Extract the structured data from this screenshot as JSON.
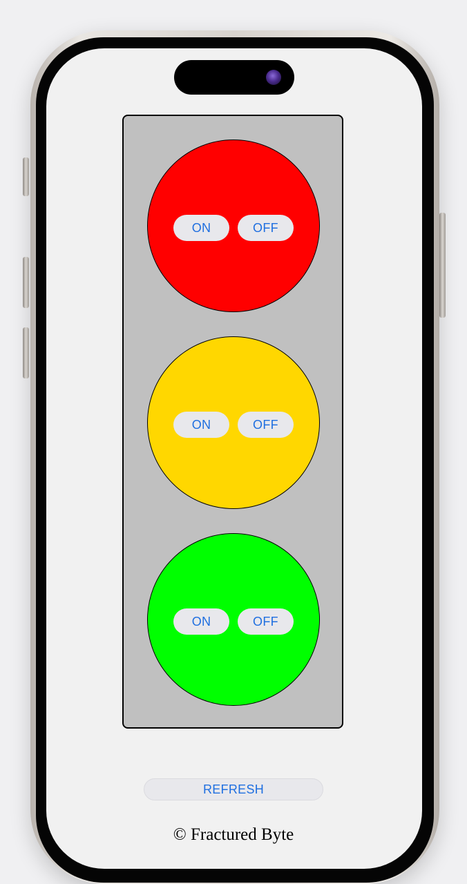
{
  "lights": [
    {
      "color_name": "red",
      "color": "#ff0000",
      "on_label": "ON",
      "off_label": "OFF"
    },
    {
      "color_name": "yellow",
      "color": "#ffd700",
      "on_label": "ON",
      "off_label": "OFF"
    },
    {
      "color_name": "green",
      "color": "#00ff00",
      "on_label": "ON",
      "off_label": "OFF"
    }
  ],
  "refresh_label": "REFRESH",
  "footer": "© Fractured Byte",
  "colors": {
    "housing": "#c0c0c0",
    "button_text": "#1f6fe0",
    "button_bg": "#e8e8ec",
    "screen_bg": "#f1f1f1"
  }
}
